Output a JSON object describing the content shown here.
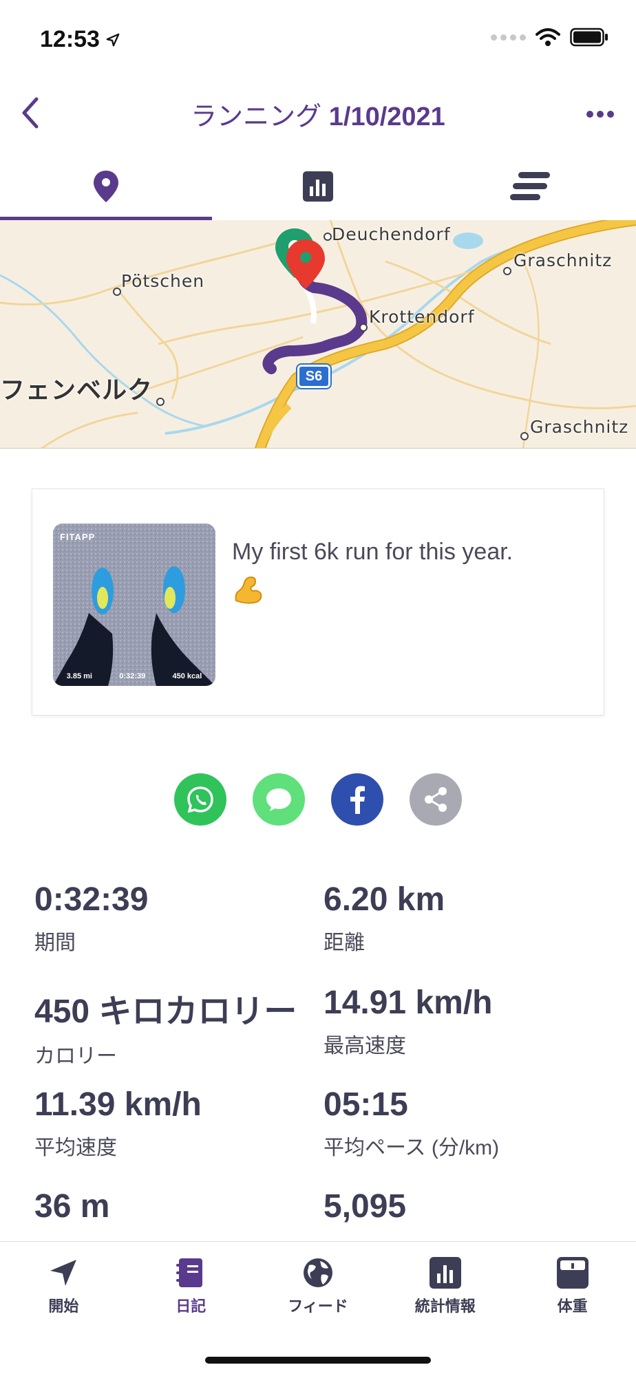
{
  "status_bar": {
    "time": "12:53"
  },
  "nav": {
    "title_prefix": "ランニング",
    "title_date": "1/10/2021"
  },
  "tabs": [
    {
      "icon": "map-pin-icon",
      "active": true
    },
    {
      "icon": "bar-chart-icon",
      "active": false
    },
    {
      "icon": "list-icon",
      "active": false
    }
  ],
  "map": {
    "labels": {
      "deuchendorf": "Deuchendorf",
      "potschen": "Pötschen",
      "graschnitz_top": "Graschnitz",
      "krottendorf": "Krottendorf",
      "kapfenberg": "フェンベルク",
      "graschnitz_bottom": "Graschnitz"
    },
    "road_badge": "S6",
    "route_color": "#5a3a8c",
    "start_pin_color": "#1f9e6e",
    "end_pin_color": "#e8392f"
  },
  "note": {
    "text": "My first 6k run for this year.",
    "photo": {
      "brand": "FITAPP",
      "distance": "3.85 mi",
      "duration": "0:32:39",
      "calories": "450 kcal"
    }
  },
  "share": [
    {
      "icon": "whatsapp-icon",
      "color": "#2fc35a"
    },
    {
      "icon": "message-icon",
      "color": "#5fe07a"
    },
    {
      "icon": "facebook-icon",
      "color": "#2f4fae"
    },
    {
      "icon": "share-icon",
      "color": "#a9a9b4"
    }
  ],
  "stats": [
    {
      "value": "0:32:39",
      "label": "期間"
    },
    {
      "value": "6.20 km",
      "label": "距離"
    },
    {
      "value": "450 キロカロリー",
      "label": "カロリー"
    },
    {
      "value": "14.91 km/h",
      "label": "最高速度"
    },
    {
      "value": "11.39 km/h",
      "label": "平均速度"
    },
    {
      "value": "05:15",
      "label": "平均ペース (分/km)"
    },
    {
      "value": "36 m",
      "label": ""
    },
    {
      "value": "5,095",
      "label": ""
    }
  ],
  "tabbar": [
    {
      "label": "開始",
      "icon": "navigation-arrow-icon",
      "active": false
    },
    {
      "label": "日記",
      "icon": "diary-icon",
      "active": true
    },
    {
      "label": "フィード",
      "icon": "globe-icon",
      "active": false
    },
    {
      "label": "統計情報",
      "icon": "statistics-icon",
      "active": false
    },
    {
      "label": "体重",
      "icon": "scale-icon",
      "active": false
    }
  ],
  "colors": {
    "accent": "#5a3a8c",
    "text_dark": "#3d3d55",
    "map_bg": "#f6efe1",
    "highway": "#f5c643"
  }
}
